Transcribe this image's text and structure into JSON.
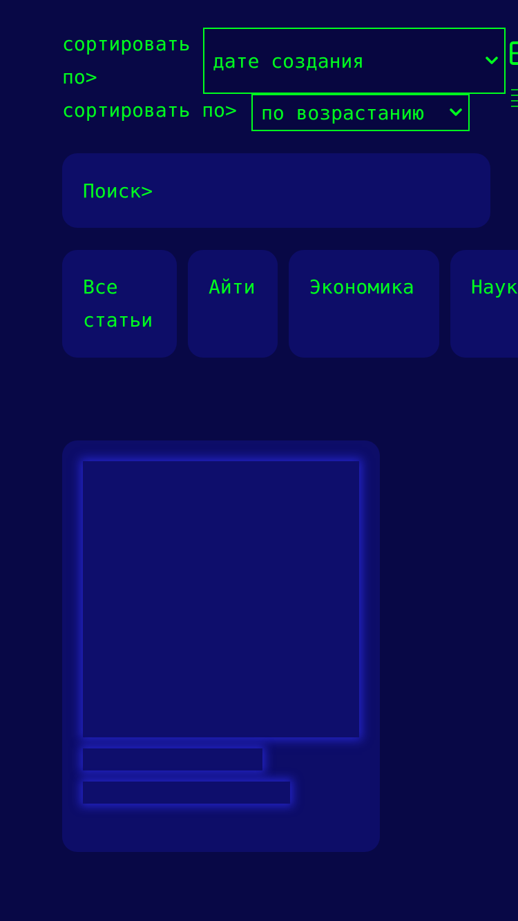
{
  "sort": {
    "field_label": "сортировать по>",
    "field_value": "дате создания",
    "order_label": "сортировать по>",
    "order_value": "по возрастанию"
  },
  "search": {
    "label": "Поиск>"
  },
  "categories": [
    {
      "label": "Все статьи"
    },
    {
      "label": "Айти"
    },
    {
      "label": "Экономика"
    },
    {
      "label": "Наука"
    }
  ],
  "colors": {
    "background": "#080846",
    "surface": "#0d0d68",
    "accent": "#00ff1e",
    "skeleton_glow": "#2424c8"
  },
  "icons": {
    "select_arrow": "chevron-down-icon",
    "view_toggle": "grid-icon",
    "filter": "menu-icon"
  }
}
